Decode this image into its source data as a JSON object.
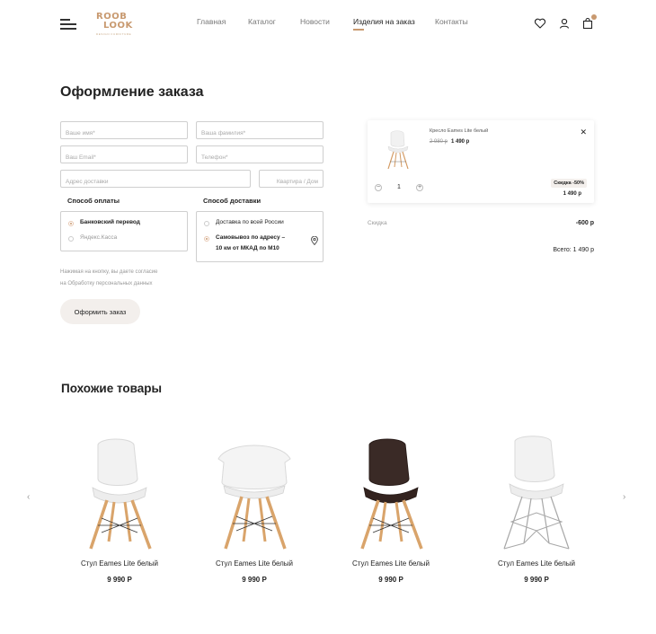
{
  "header": {
    "logo_line1": "ROOB",
    "logo_line2": "LOOK",
    "logo_tagline": "DESIGN FURNITURE",
    "nav": [
      {
        "label": "Главная"
      },
      {
        "label": "Каталог"
      },
      {
        "label": "Новости"
      },
      {
        "label": "Изделия на заказ",
        "active": true
      },
      {
        "label": "Контакты"
      }
    ],
    "icons": [
      "menu-icon",
      "heart-icon",
      "user-icon",
      "cart-icon"
    ]
  },
  "checkout": {
    "title": "Оформление заказа",
    "fields": {
      "first_name": "Ваше имя*",
      "last_name": "Ваша фамилия*",
      "email": "Ваш Email*",
      "phone": "Телефон*",
      "address": "Адрес доставки",
      "apartment": "Квартира / Дом"
    },
    "payment": {
      "title": "Способ оплаты",
      "options": [
        "Банковский перевод",
        "Яндекс.Касса"
      ],
      "selected": 0
    },
    "delivery": {
      "title": "Способ доставки",
      "options": [
        "Доставка по всей России",
        "Самовывоз по адресу –",
        "10 км от МКАД по М10"
      ],
      "selected": 1
    },
    "consent_line1": "Нажимая на кнопку, вы даете согласие",
    "consent_line2": "на Обработку персональных данных",
    "submit_label": "Оформить заказ"
  },
  "cart": {
    "item_name": "Кресло Eames Lite белый",
    "old_price": "2 980 р",
    "price": "1 490 р",
    "quantity": "1",
    "discount_badge": "Скидка -50%",
    "item_total": "1 490 р",
    "discount_label": "Скидка",
    "discount_value": "-600 р",
    "grand_total": "Всего: 1 490 р"
  },
  "related": {
    "title": "Похожие товары",
    "products": [
      {
        "name": "Стул Eames Lite белый",
        "price": "9 990 Р",
        "seat_color": "#f2f2f2",
        "legs": "wood"
      },
      {
        "name": "Стул Eames Lite белый",
        "price": "9 990 Р",
        "seat_color": "#f4f4f4",
        "legs": "wood"
      },
      {
        "name": "Стул Eames Lite белый",
        "price": "9 990 Р",
        "seat_color": "#3a2a26",
        "legs": "wood"
      },
      {
        "name": "Стул Eames Lite белый",
        "price": "9 990 Р",
        "seat_color": "#f2f2f2",
        "legs": "metal"
      }
    ]
  },
  "colors": {
    "accent": "#c8996f",
    "button_bg": "#f3efec",
    "text": "#222222",
    "muted": "#999999"
  }
}
